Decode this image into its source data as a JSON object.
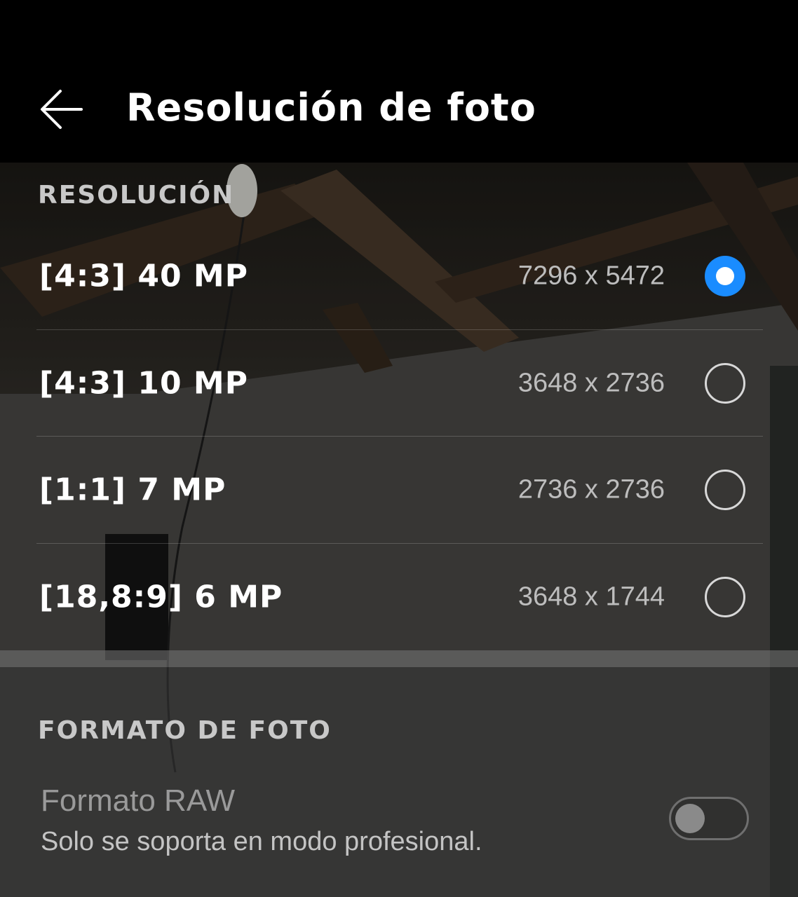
{
  "header": {
    "title": "Resolución de foto"
  },
  "sections": {
    "resolution": {
      "label": "RESOLUCIÓN",
      "options": [
        {
          "label": "[4:3]  40 MP",
          "dims": "7296 x 5472",
          "selected": true
        },
        {
          "label": "[4:3]  10 MP",
          "dims": "3648 x 2736",
          "selected": false
        },
        {
          "label": "[1:1]  7 MP",
          "dims": "2736 x 2736",
          "selected": false
        },
        {
          "label": "[18,8:9]  6 MP",
          "dims": "3648 x 1744",
          "selected": false
        }
      ]
    },
    "format": {
      "label": "FORMATO DE FOTO",
      "raw": {
        "title": "Formato RAW",
        "subtitle": "Solo se soporta en modo profesional.",
        "enabled": false
      }
    }
  },
  "colors": {
    "accent": "#1a8cff"
  },
  "icons": {
    "back": "back-arrow-icon"
  }
}
